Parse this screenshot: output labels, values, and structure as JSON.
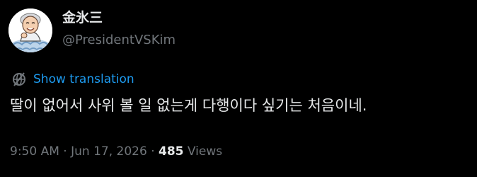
{
  "author": {
    "display_name": "金氷三",
    "handle": "@PresidentVSKim",
    "avatar_icon": "cartoon-portrait-avatar"
  },
  "translation": {
    "icon": "globe-translate-icon",
    "label": "Show translation"
  },
  "tweet": {
    "text": "딸이 없어서 사위 볼 일 없는게 다행이다 싶기는 처음이네."
  },
  "meta": {
    "time": "9:50 AM",
    "separator": "·",
    "date": "Jun 17, 2026",
    "views_count": "485",
    "views_label": "Views"
  },
  "colors": {
    "background": "#000000",
    "text_primary": "#e7e9ea",
    "text_secondary": "#71767b",
    "link": "#1d9bf0"
  }
}
